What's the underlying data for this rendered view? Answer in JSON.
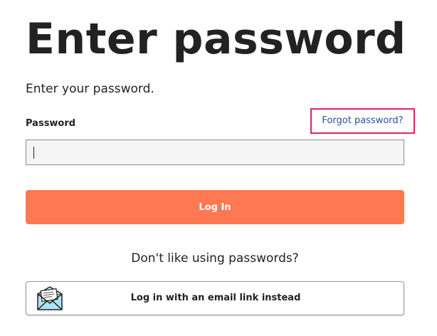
{
  "header": {
    "title": "Enter password",
    "subtitle": "Enter your password."
  },
  "form": {
    "password_label": "Password",
    "forgot_link": "Forgot password?",
    "password_value": "",
    "login_button": "Log In"
  },
  "alternatives": {
    "prompt": "Don't like using passwords?",
    "email_link_button": "Log in with an email link instead",
    "email_link_icon": "envelope-icon"
  },
  "colors": {
    "accent": "#fd7853",
    "link": "#1f55a0",
    "highlight_border": "#e0245e",
    "input_background": "#f5f5f5"
  }
}
